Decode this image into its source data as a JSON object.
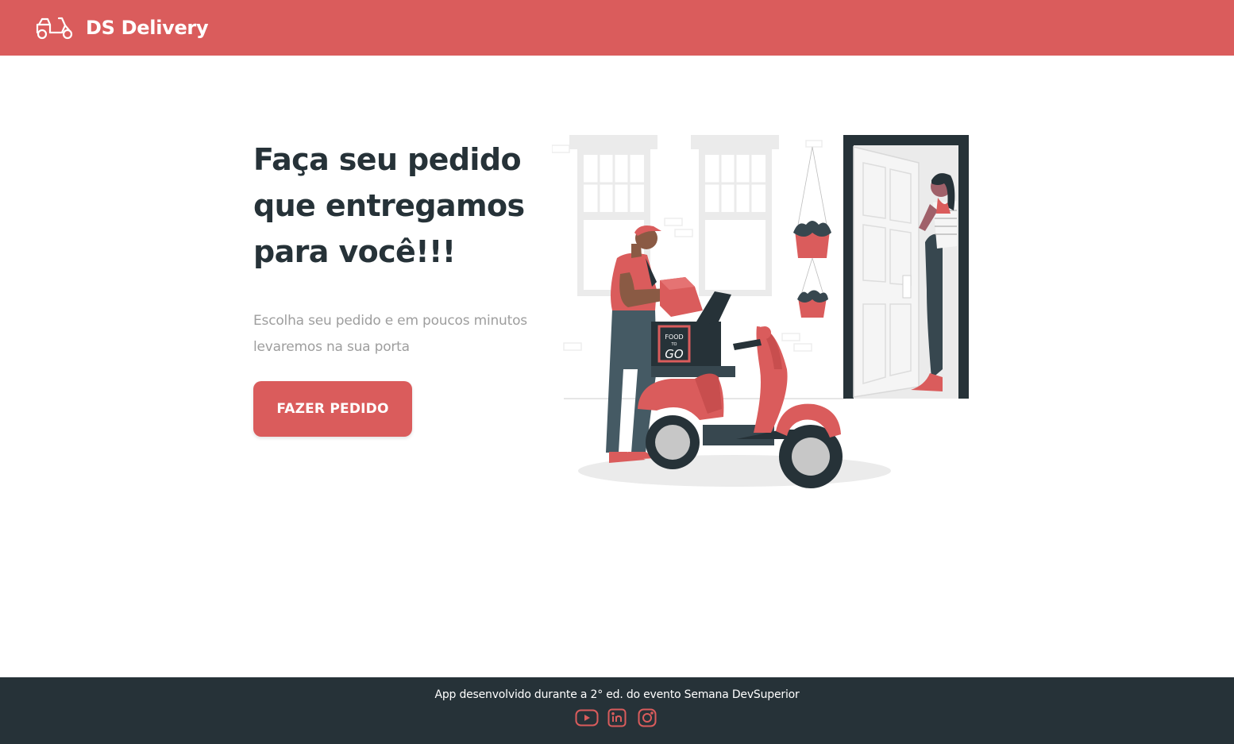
{
  "navbar": {
    "brand": "DS Delivery",
    "logo_icon": "scooter-icon",
    "background_color": "#DA5C5C"
  },
  "home": {
    "title_line1": "Faça seu pedido",
    "title_line2": "que entregamos",
    "title_line3": "para você!!!",
    "subtitle_line1": "Escolha seu pedido e em poucos minutos",
    "subtitle_line2": "levaremos na sua porta",
    "cta_label": "FAZER PEDIDO"
  },
  "illustration": {
    "badge_line1": "FOOD",
    "badge_line2": "TO",
    "badge_line3": "GO"
  },
  "footer": {
    "text": "App desenvolvido durante a 2° ed. do evento Semana DevSuperior",
    "social": [
      "youtube-icon",
      "linkedin-icon",
      "instagram-icon"
    ],
    "background_color": "#263238"
  }
}
